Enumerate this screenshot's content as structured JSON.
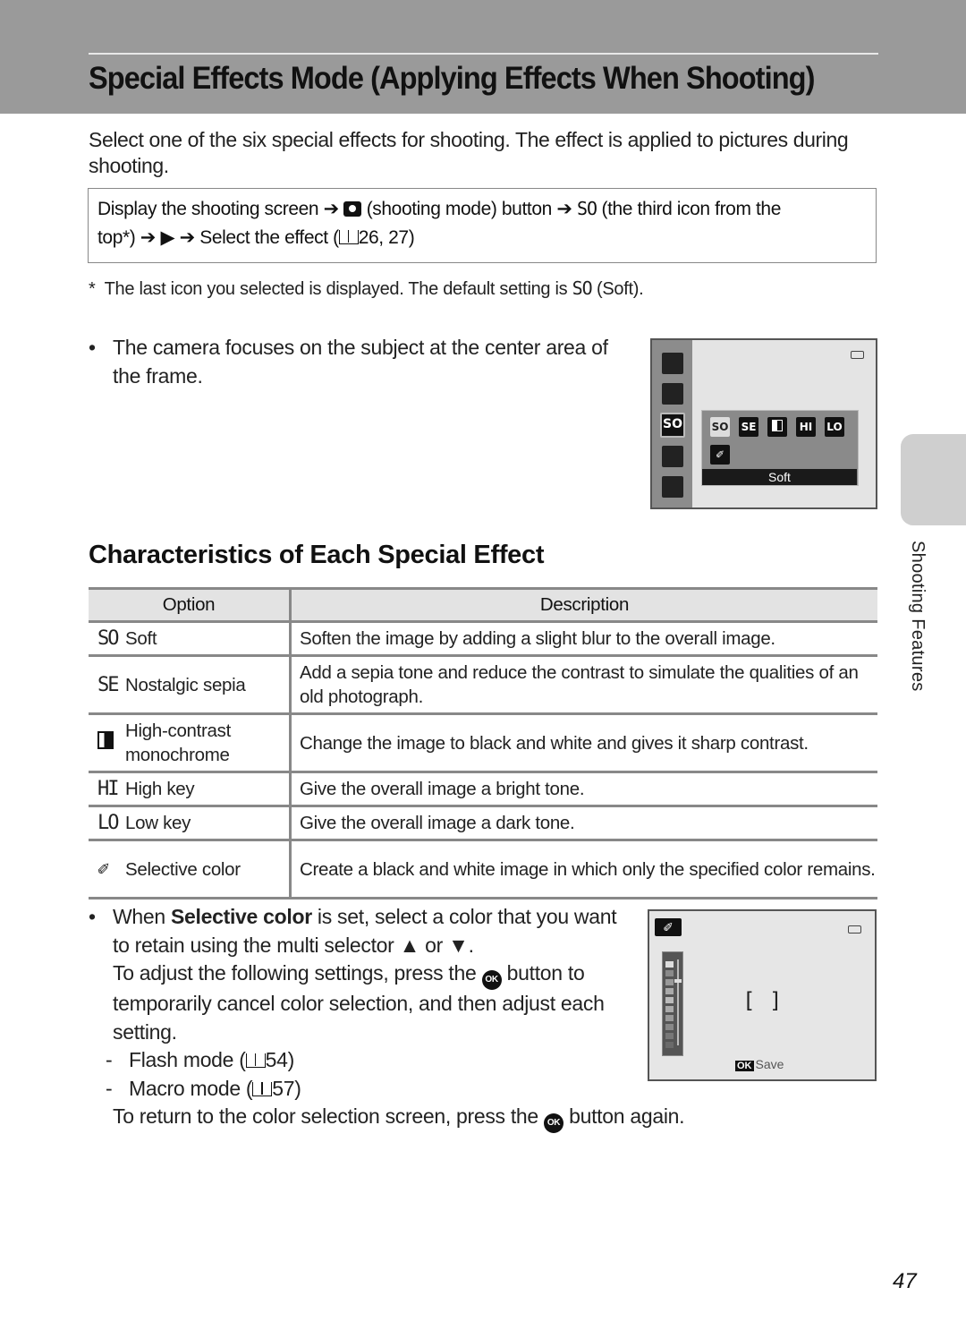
{
  "header": {
    "title": "Special Effects Mode (Applying Effects When Shooting)"
  },
  "intro": "Select one of the six special effects for shooting. The effect is applied to pictures during shooting.",
  "procedure": {
    "line1_a": "Display the shooting screen",
    "arrow": "➔",
    "line1_b": "(shooting mode) button",
    "so_icon": "SO",
    "line1_c": "(the third icon from the",
    "line2_a": "top*)",
    "play": "▶",
    "line2_b": "Select the effect (",
    "line2_pages": "26, 27)"
  },
  "footnote": {
    "marker": "*",
    "text_a": "The last icon you selected is displayed. The default setting is",
    "so_icon": "SO",
    "text_b": "(Soft)."
  },
  "bullet1": {
    "dot": "•",
    "text": "The camera focuses on the subject at the center area of the frame."
  },
  "camera_screen_1": {
    "side_selected": "SO",
    "effects": [
      "SO",
      "SE",
      "",
      "HI",
      "LO"
    ],
    "dropper_icon": "✐",
    "selected_label": "Soft"
  },
  "section_title": "Characteristics of Each Special Effect",
  "table": {
    "headers": {
      "option": "Option",
      "description": "Description"
    },
    "rows": [
      {
        "icon": "SO",
        "option": "Soft",
        "description": "Soften the image by adding a slight blur to the overall image."
      },
      {
        "icon": "SE",
        "option": "Nostalgic sepia",
        "description": "Add a sepia tone and reduce the contrast to simulate the qualities of an old photograph."
      },
      {
        "icon": "",
        "option": "High-contrast monochrome",
        "description": "Change the image to black and white and gives it sharp contrast."
      },
      {
        "icon": "HI",
        "option": "High key",
        "description": "Give the overall image a bright tone."
      },
      {
        "icon": "LO",
        "option": "Low key",
        "description": "Give the overall image a dark tone."
      },
      {
        "icon": "✐",
        "option": "Selective color",
        "description": "Create a black and white image in which only the specified color remains."
      }
    ]
  },
  "bullet2": {
    "dot": "•",
    "t1": "When ",
    "bold": "Selective color",
    "t2": " is set, select a color that you want to retain using the multi selector ▲ or ▼.",
    "t3": "To adjust the following settings, press the ",
    "ok": "OK",
    "t4": " button to temporarily cancel color selection, and then adjust each setting.",
    "sub_items": [
      {
        "dash": "-",
        "label": "Flash mode (",
        "page": "54)"
      },
      {
        "dash": "-",
        "label": "Macro mode (",
        "page": "57)"
      }
    ],
    "t5": "To return to the color selection screen, press the ",
    "t6": " button again."
  },
  "camera_screen_2": {
    "dropper_icon": "✐",
    "bracket_left": "[",
    "bracket_right": "]",
    "ok": "OK",
    "save": "Save"
  },
  "side_tab": {
    "label": "Shooting Features"
  },
  "page_number": "47"
}
